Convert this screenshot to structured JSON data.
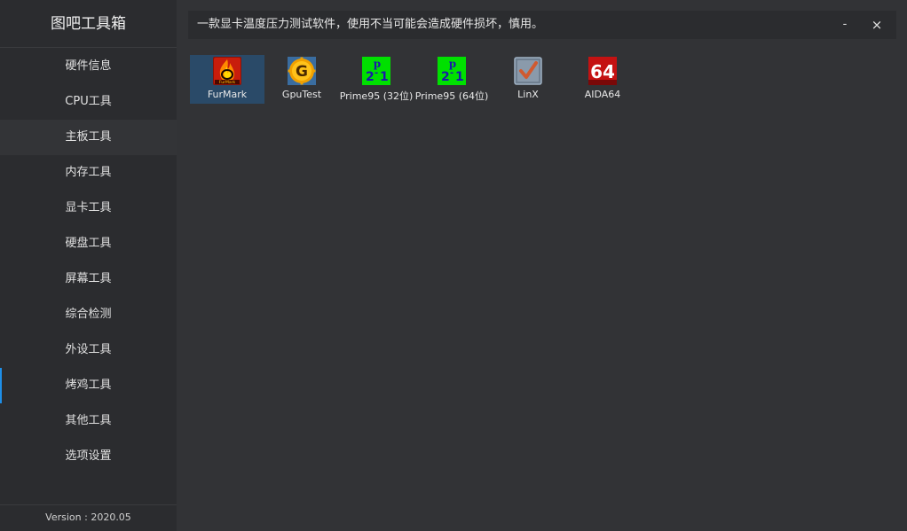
{
  "app": {
    "title": "图吧工具箱",
    "version": "Version : 2020.05"
  },
  "sidebar": {
    "items": [
      {
        "label": "硬件信息"
      },
      {
        "label": "CPU工具"
      },
      {
        "label": "主板工具",
        "state": "hover"
      },
      {
        "label": "内存工具"
      },
      {
        "label": "显卡工具"
      },
      {
        "label": "硬盘工具"
      },
      {
        "label": "屏幕工具"
      },
      {
        "label": "综合检测"
      },
      {
        "label": "外设工具"
      },
      {
        "label": "烤鸡工具",
        "state": "active"
      },
      {
        "label": "其他工具"
      },
      {
        "label": "选项设置"
      }
    ]
  },
  "header": {
    "warning": "一款显卡温度压力测试软件，使用不当可能会造成硬件损坏，慎用。",
    "minimize": "-",
    "close": "×"
  },
  "tools": [
    {
      "label": "FurMark",
      "icon": "furmark-icon",
      "selected": true
    },
    {
      "label": "GpuTest",
      "icon": "gputest-icon"
    },
    {
      "label": "Prime95 (32位)",
      "icon": "prime95-icon"
    },
    {
      "label": "Prime95 (64位)",
      "icon": "prime95-icon"
    },
    {
      "label": "LinX",
      "icon": "linx-icon"
    },
    {
      "label": "AIDA64",
      "icon": "aida64-icon"
    }
  ],
  "colors": {
    "accent": "#1e8fe8",
    "selected_bg": "#2a4a68",
    "sidebar_bg": "#2b2c2f",
    "main_bg": "#323336"
  }
}
